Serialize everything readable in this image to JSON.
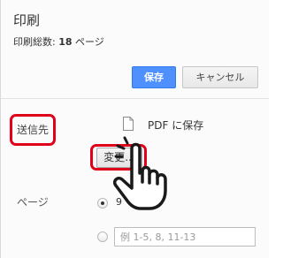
{
  "dialog": {
    "title": "印刷",
    "summary_label": "印刷総数:",
    "summary_count": "18",
    "summary_unit": "ページ"
  },
  "buttons": {
    "save_label": "保存",
    "cancel_label": "キャンセル",
    "change_label": "変更..."
  },
  "destination": {
    "label": "送信先",
    "value": "PDF に保存",
    "icon": "file-icon"
  },
  "pages": {
    "label": "ページ",
    "all_option_label": "9",
    "range_placeholder": "例 1-5, 8, 11-13"
  },
  "annotations": {
    "highlight_color": "#e0001a",
    "pointer_icon": "hand-pointer-icon"
  },
  "colors": {
    "primary_button": "#4d90fe"
  }
}
